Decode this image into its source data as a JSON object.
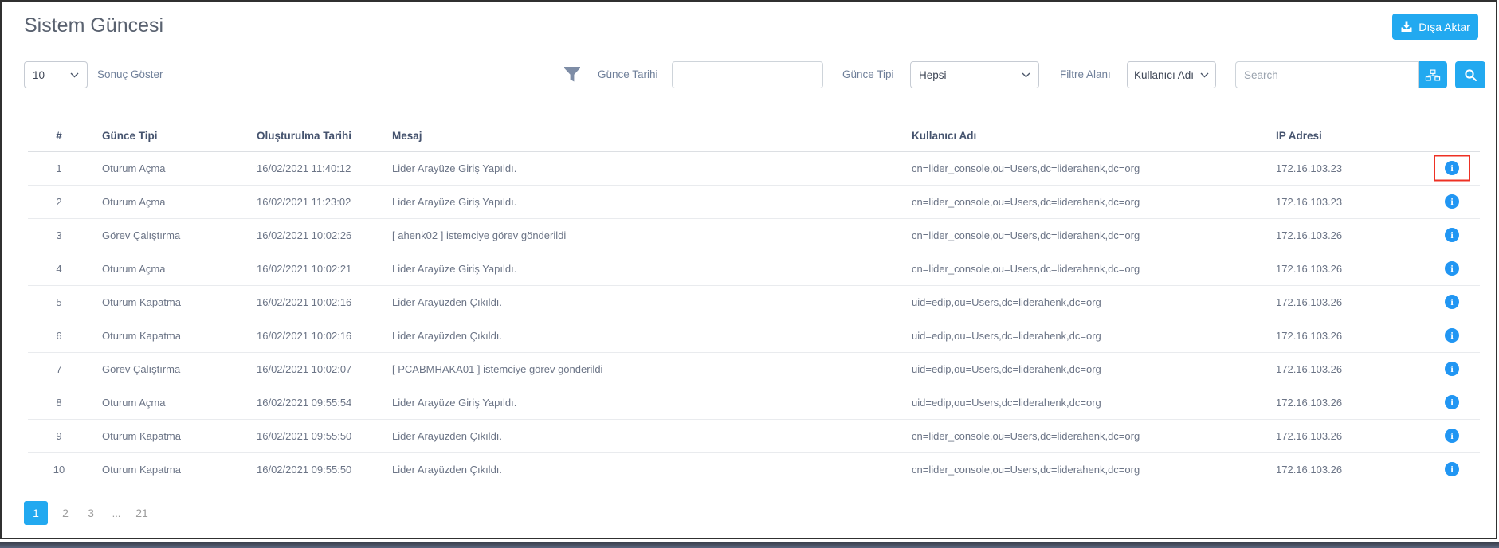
{
  "page": {
    "title": "Sistem Güncesi"
  },
  "toolbar": {
    "export_label": "Dışa Aktar",
    "export_icon": "download-icon"
  },
  "filters": {
    "page_size": {
      "value": "10",
      "label": "Sonuç Göster"
    },
    "filter_icon": "funnel-icon",
    "date": {
      "label": "Günce Tarihi",
      "value": ""
    },
    "type": {
      "label": "Günce Tipi",
      "value": "Hepsi"
    },
    "filter_field": {
      "label": "Filtre Alanı",
      "value": "Kullanıcı Adı"
    },
    "search": {
      "placeholder": "Search",
      "value": "",
      "tree_button_icon": "sitemap-icon",
      "search_button_icon": "search-icon"
    }
  },
  "table": {
    "columns": [
      "#",
      "Günce Tipi",
      "Oluşturulma Tarihi",
      "Mesaj",
      "Kullanıcı Adı",
      "IP Adresi"
    ],
    "row_action_icon": "info-icon",
    "rows": [
      {
        "index": "1",
        "type": "Oturum Açma",
        "created": "16/02/2021 11:40:12",
        "message": "Lider Arayüze Giriş Yapıldı.",
        "user": "cn=lider_console,ou=Users,dc=liderahenk,dc=org",
        "ip": "172.16.103.23",
        "highlighted": true
      },
      {
        "index": "2",
        "type": "Oturum Açma",
        "created": "16/02/2021 11:23:02",
        "message": "Lider Arayüze Giriş Yapıldı.",
        "user": "cn=lider_console,ou=Users,dc=liderahenk,dc=org",
        "ip": "172.16.103.23",
        "highlighted": false
      },
      {
        "index": "3",
        "type": "Görev Çalıştırma",
        "created": "16/02/2021 10:02:26",
        "message": "[ ahenk02 ] istemciye görev gönderildi",
        "user": "cn=lider_console,ou=Users,dc=liderahenk,dc=org",
        "ip": "172.16.103.26",
        "highlighted": false
      },
      {
        "index": "4",
        "type": "Oturum Açma",
        "created": "16/02/2021 10:02:21",
        "message": "Lider Arayüze Giriş Yapıldı.",
        "user": "cn=lider_console,ou=Users,dc=liderahenk,dc=org",
        "ip": "172.16.103.26",
        "highlighted": false
      },
      {
        "index": "5",
        "type": "Oturum Kapatma",
        "created": "16/02/2021 10:02:16",
        "message": "Lider Arayüzden Çıkıldı.",
        "user": "uid=edip,ou=Users,dc=liderahenk,dc=org",
        "ip": "172.16.103.26",
        "highlighted": false
      },
      {
        "index": "6",
        "type": "Oturum Kapatma",
        "created": "16/02/2021 10:02:16",
        "message": "Lider Arayüzden Çıkıldı.",
        "user": "uid=edip,ou=Users,dc=liderahenk,dc=org",
        "ip": "172.16.103.26",
        "highlighted": false
      },
      {
        "index": "7",
        "type": "Görev Çalıştırma",
        "created": "16/02/2021 10:02:07",
        "message": "[ PCABMHAKA01 ] istemciye görev gönderildi",
        "user": "uid=edip,ou=Users,dc=liderahenk,dc=org",
        "ip": "172.16.103.26",
        "highlighted": false
      },
      {
        "index": "8",
        "type": "Oturum Açma",
        "created": "16/02/2021 09:55:54",
        "message": "Lider Arayüze Giriş Yapıldı.",
        "user": "uid=edip,ou=Users,dc=liderahenk,dc=org",
        "ip": "172.16.103.26",
        "highlighted": false
      },
      {
        "index": "9",
        "type": "Oturum Kapatma",
        "created": "16/02/2021 09:55:50",
        "message": "Lider Arayüzden Çıkıldı.",
        "user": "cn=lider_console,ou=Users,dc=liderahenk,dc=org",
        "ip": "172.16.103.26",
        "highlighted": false
      },
      {
        "index": "10",
        "type": "Oturum Kapatma",
        "created": "16/02/2021 09:55:50",
        "message": "Lider Arayüzden Çıkıldı.",
        "user": "cn=lider_console,ou=Users,dc=liderahenk,dc=org",
        "ip": "172.16.103.26",
        "highlighted": false
      }
    ]
  },
  "pagination": {
    "pages": [
      "1",
      "2",
      "3",
      "...",
      "21"
    ],
    "active": "1"
  },
  "colors": {
    "accent_blue": "#22A9F0",
    "info_blue": "#2196F3",
    "highlight_red": "#EE3124",
    "title_text": "#5A6270",
    "header_text": "#45536E",
    "body_text": "#6B7486",
    "label_text": "#70809A"
  }
}
